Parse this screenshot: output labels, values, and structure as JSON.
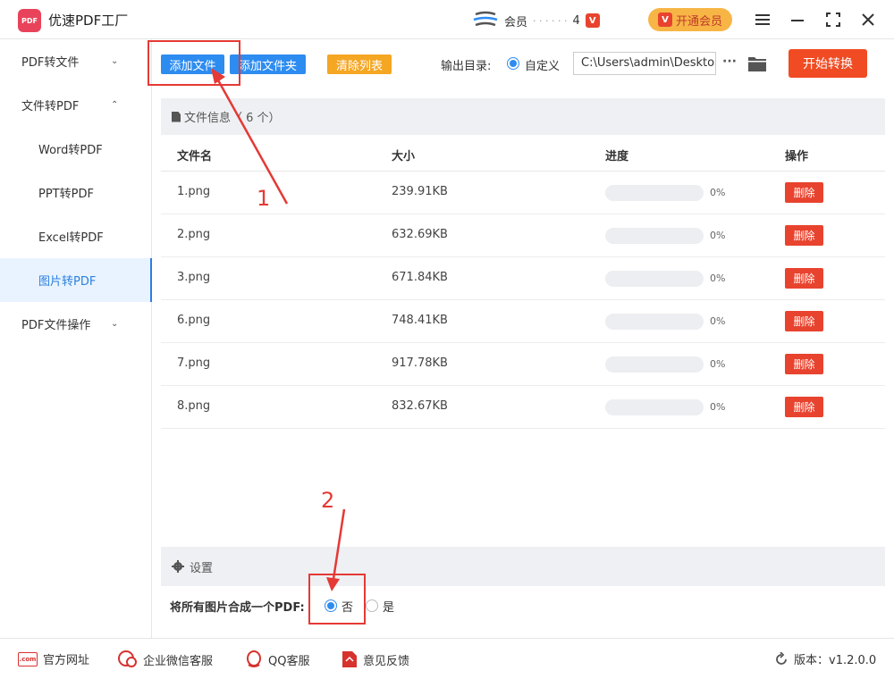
{
  "app": {
    "title": "优速PDF工厂",
    "logo_text": "PDF"
  },
  "header": {
    "member_text": "会员",
    "member_count": "4",
    "vip_badge": "V",
    "vip_button": "开通会员"
  },
  "sidebar": {
    "items": [
      {
        "label": "PDF转文件",
        "chevron": "⌄"
      },
      {
        "label": "文件转PDF",
        "chevron": "⌃"
      },
      {
        "label": "Word转PDF"
      },
      {
        "label": "PPT转PDF"
      },
      {
        "label": "Excel转PDF"
      },
      {
        "label": "图片转PDF"
      },
      {
        "label": "PDF文件操作",
        "chevron": "⌄"
      }
    ]
  },
  "toolbar": {
    "add_file": "添加文件",
    "add_folder": "添加文件夹",
    "clear_list": "清除列表",
    "output_label": "输出目录:",
    "custom_label": "自定义",
    "output_path": "C:\\Users\\admin\\Deskto",
    "more": "···",
    "start": "开始转换"
  },
  "file_panel": {
    "title": "文件信息（ 6 个）",
    "columns": [
      "文件名",
      "大小",
      "进度",
      "操作"
    ],
    "delete_label": "删除",
    "rows": [
      {
        "name": "1.png",
        "size": "239.91KB",
        "progress": "0%"
      },
      {
        "name": "2.png",
        "size": "632.69KB",
        "progress": "0%"
      },
      {
        "name": "3.png",
        "size": "671.84KB",
        "progress": "0%"
      },
      {
        "name": "6.png",
        "size": "748.41KB",
        "progress": "0%"
      },
      {
        "name": "7.png",
        "size": "917.78KB",
        "progress": "0%"
      },
      {
        "name": "8.png",
        "size": "832.67KB",
        "progress": "0%"
      }
    ]
  },
  "settings": {
    "title": "设置",
    "merge_label": "将所有图片合成一个PDF:",
    "no_label": "否",
    "yes_label": "是"
  },
  "footer": {
    "website": "官方网址",
    "website_icon": ".com",
    "wechat": "企业微信客服",
    "qq": "QQ客服",
    "feedback": "意见反馈",
    "version": "版本：v1.2.0.0"
  },
  "annotations": {
    "step1": "1",
    "step2": "2"
  },
  "colors": {
    "accent_blue": "#2d8cf0",
    "start_red": "#f04b23",
    "delete_red": "#e8432e",
    "annotation_red": "#e53935",
    "vip_gold": "#f7b546"
  }
}
